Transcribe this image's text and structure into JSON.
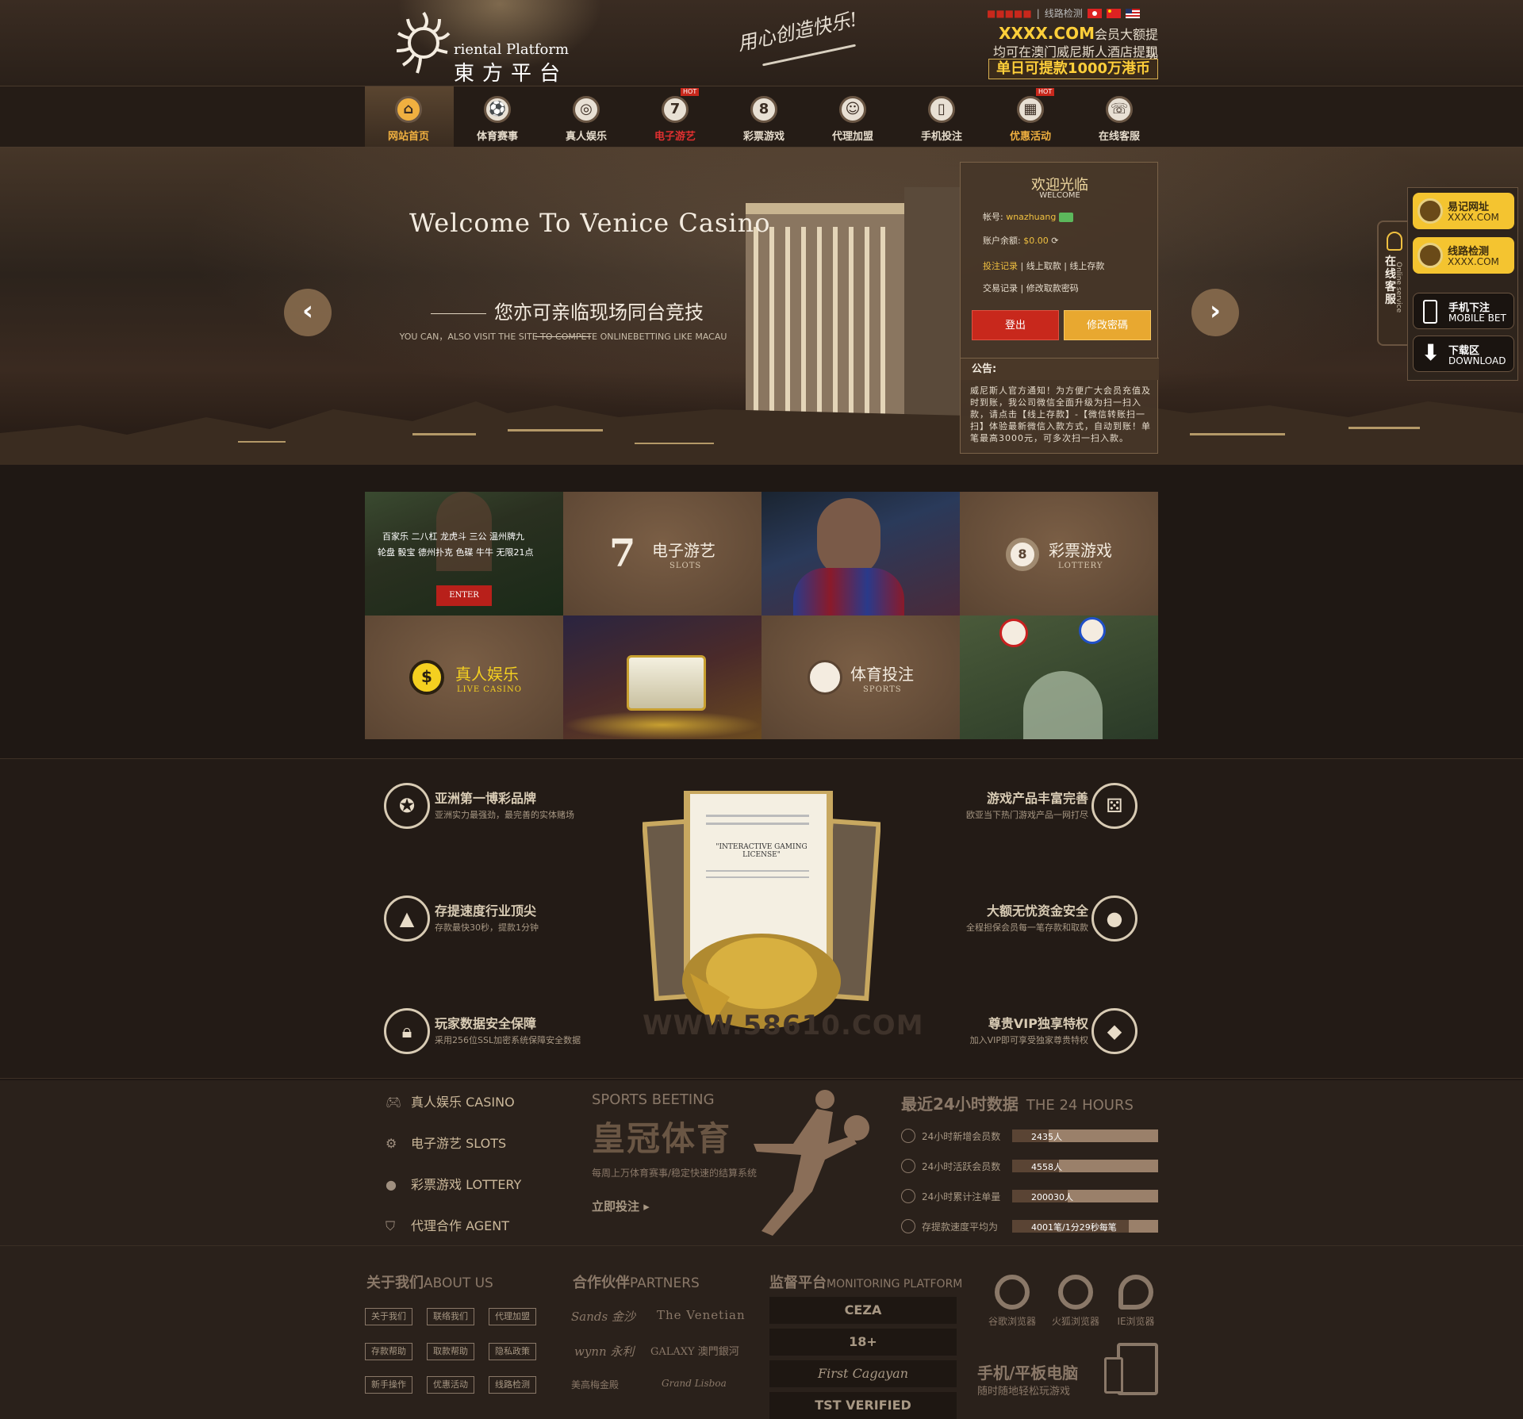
{
  "header": {
    "logo_platform": "riental  Platform",
    "logo_cn": "東方平台",
    "slogan": "用心创造快乐!",
    "top_links": {
      "mobile": "线路检测"
    },
    "promo_line1_brand": "XXXX.COM",
    "promo_line1_rest": "会员大额提现",
    "promo_line2": "均可在澳门威尼斯人酒店提现",
    "promo_line3": "单日可提款1000万港币"
  },
  "nav": {
    "items": [
      {
        "label": "网站首页",
        "icon": "home-icon",
        "glyph": "⌂"
      },
      {
        "label": "体育赛事",
        "icon": "soccer-icon",
        "glyph": "⚽"
      },
      {
        "label": "真人娱乐",
        "icon": "chip-icon",
        "glyph": "◎"
      },
      {
        "label": "电子游艺",
        "icon": "seven-icon",
        "glyph": "7",
        "hot": "HOT"
      },
      {
        "label": "彩票游戏",
        "icon": "eight-ball-icon",
        "glyph": "8"
      },
      {
        "label": "代理加盟",
        "icon": "user-icon",
        "glyph": "☺"
      },
      {
        "label": "手机投注",
        "icon": "mobile-icon",
        "glyph": "▯"
      },
      {
        "label": "优惠活动",
        "icon": "gift-icon",
        "glyph": "▦",
        "hot": "HOT"
      },
      {
        "label": "在线客服",
        "icon": "support-icon",
        "glyph": "☏"
      }
    ]
  },
  "banner": {
    "title": "Welcome To Venice Casino",
    "subtitle": "您亦可亲临现场同台竞技",
    "subtitle_en": "YOU CAN，ALSO VISIT THE SITE TO COMPETE ONLINEBETTING LIKE MACAU",
    "prev": "‹",
    "next": "›"
  },
  "login": {
    "title": "欢迎光临",
    "subtitle": "WELCOME",
    "account_label": "帐号:",
    "account_value": "wnazhuang",
    "balance_label": "账户余额:",
    "balance_value": "$0.00",
    "links1": [
      "投注记录",
      "线上取款",
      "线上存款"
    ],
    "links2": [
      "交易记录",
      "修改取款密码"
    ],
    "logout": "登出",
    "change_password": "修改密碼",
    "notice_label": "公告:",
    "notice_text": "威尼斯人官方通知！为方便广大会员充值及时到账，我公司微信全面升级为扫一扫入款，请点击【线上存款】-【微信转账扫一扫】体验最新微信入款方式，自动到账！单笔最高3000元，可多次扫一扫入款。"
  },
  "sidebar": {
    "tab_text": "在线客服",
    "tab_en": "Online service",
    "items": [
      {
        "t1": "易记网址",
        "t2": "XXXX.COM"
      },
      {
        "t1": "线路检测",
        "t2": "XXXX.COM"
      },
      {
        "t1": "手机下注",
        "t2": "MOBILE BET"
      },
      {
        "t1": "下载区",
        "t2": "DOWNLOAD"
      }
    ]
  },
  "grid": {
    "casino_games_line1": "百家乐  二八杠  龙虎斗  三公  温州牌九",
    "casino_games_line2": "轮盘  骰宝  德州扑克  色碟  牛牛  无限21点",
    "enter": "ENTER",
    "slots_cn": "电子游艺",
    "slots_en": "SLOTS",
    "lottery_cn": "彩票游戏",
    "lottery_en": "LOTTERY",
    "live_cn": "真人娱乐",
    "live_en": "LIVE CASINO",
    "sports_cn": "体育投注",
    "sports_en": "SPORTS"
  },
  "features": {
    "left": [
      {
        "title": "亚洲第一博彩品牌",
        "desc": "亚洲实力最强劲，最完善的实体赌场"
      },
      {
        "title": "存提速度行业顶尖",
        "desc": "存款最快30秒，提款1分钟"
      },
      {
        "title": "玩家数据安全保障",
        "desc": "采用256位SSL加密系统保障安全数据"
      }
    ],
    "right": [
      {
        "title": "游戏产品丰富完善",
        "desc": "欧亚当下热门游戏产品一网打尽"
      },
      {
        "title": "大额无忧资金安全",
        "desc": "全程担保会员每一笔存款和取款"
      },
      {
        "title": "尊贵VIP独享特权",
        "desc": "加入VIP即可享受独家尊贵特权"
      }
    ],
    "cert_text": "\"INTERACTIVE GAMING LICENSE\"",
    "watermark": "WWW.58610.COM"
  },
  "stats": {
    "games": [
      {
        "cn": "真人娱乐",
        "en": "CASINO"
      },
      {
        "cn": "电子游艺",
        "en": "SLOTS"
      },
      {
        "cn": "彩票游戏",
        "en": "LOTTERY"
      },
      {
        "cn": "代理合作",
        "en": "AGENT"
      }
    ],
    "sports_en": "SPORTS BEETING",
    "sports_cn": "皇冠体育",
    "sports_desc": "每周上万体育赛事/稳定快速的结算系统",
    "sports_cta": "立即投注 ▸",
    "h24_cn": "最近24小时数据",
    "h24_en": "THE 24 HOURS",
    "rows": [
      {
        "label": "24小时新增会员数",
        "value": "2435人",
        "fill": 0.25
      },
      {
        "label": "24小时活跃会员数",
        "value": "4558人",
        "fill": 0.32
      },
      {
        "label": "24小时累计注单量",
        "value": "200030人",
        "fill": 0.38
      },
      {
        "label": "存提款速度平均为",
        "value": "4001笔/1分29秒每笔",
        "fill": 0.8
      }
    ]
  },
  "footer": {
    "about_cn": "关于我们",
    "about_en": "ABOUT US",
    "about_links": [
      "关于我们",
      "联络我们",
      "代理加盟",
      "存款帮助",
      "取款帮助",
      "隐私政策",
      "新手操作",
      "优惠活动",
      "线路检测"
    ],
    "partners_cn": "合作伙伴",
    "partners_en": "PARTNERS",
    "partners": [
      "Sands 金沙",
      "The Venetian",
      "wynn 永利",
      "GALAXY 澳門銀河",
      "美高梅金殿",
      "Grand Lisboa"
    ],
    "monitor_cn": "监督平台",
    "monitor_en": "MONITORING PLATFORM",
    "monitors": [
      "CEZA",
      "18+",
      "First Cagayan",
      "TST VERIFIED"
    ],
    "browsers": [
      "谷歌浏览器",
      "火狐浏览器",
      "IE浏览器"
    ],
    "mobile_title": "手机/平板电脑",
    "mobile_desc": "随时随地轻松玩游戏"
  }
}
